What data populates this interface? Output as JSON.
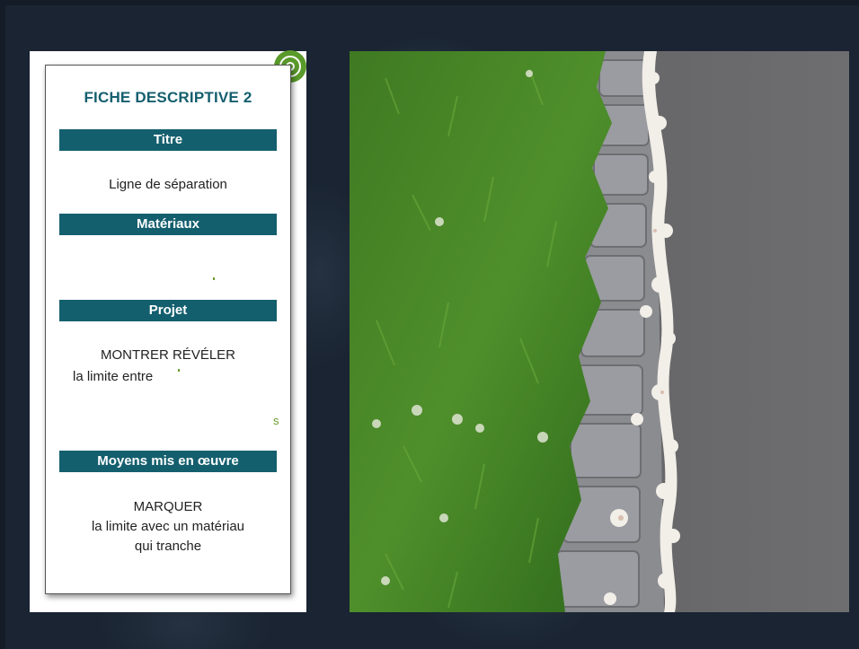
{
  "card": {
    "title": "FICHE DESCRIPTIVE 2",
    "sections": [
      {
        "heading": "Titre",
        "lines": [
          "Ligne de séparation"
        ]
      },
      {
        "heading": "Matériaux",
        "lines": []
      },
      {
        "heading": "Projet",
        "lines": [
          "MONTRER RÉVÉLER",
          "la limite entre"
        ]
      },
      {
        "heading": "Moyens mis en œuvre",
        "lines": [
          "MARQUER",
          "la limite avec un matériau",
          "qui tranche"
        ]
      }
    ],
    "stray_char": "s"
  },
  "icon": "disc-icon",
  "photo": {
    "description_icon": "photo-grass-curb-pavement"
  },
  "colors": {
    "accent": "#145f6e",
    "icon_green": "#5a9a2a"
  }
}
